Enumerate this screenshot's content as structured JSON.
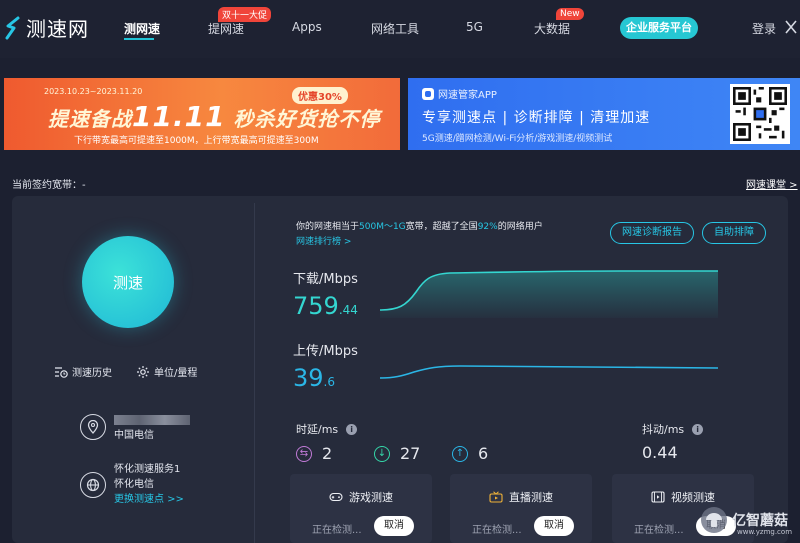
{
  "app": {
    "name": "测速网"
  },
  "nav": {
    "items": [
      {
        "label": "测网速",
        "active": true
      },
      {
        "label": "提网速",
        "badge": "双十一大促"
      },
      {
        "label": "Apps"
      },
      {
        "label": "网络工具"
      },
      {
        "label": "5G"
      },
      {
        "label": "大数据",
        "badge": "New"
      }
    ],
    "cta": "企业服务平台",
    "login": "登录"
  },
  "banner_left": {
    "date": "2023.10.23~2023.11.20",
    "title_a": "提速备战",
    "title_b": "11.11",
    "title_c": "秒杀好货抢不停",
    "pill": "优惠30%",
    "sub": "下行带宽最高可提速至1000M，上行带宽最高可提速至300M"
  },
  "banner_right": {
    "app": "网速管家APP",
    "title": "专享测速点 | 诊断排障 | 清理加速",
    "sub": "5G测速/蹭网检测/Wi-Fi分析/游戏测速/视频测试"
  },
  "bandwidth": {
    "label": "当前签约宽带：-"
  },
  "course_link": "网速课堂 >",
  "speed_button": "测速",
  "tools": {
    "history": "测速历史",
    "units": "单位/量程"
  },
  "server": {
    "isp1": "中国电信",
    "node": "怀化测速服务1",
    "isp2": "怀化电信",
    "change": "更换测速点 >>"
  },
  "headline": {
    "prefix": "你的网速相当于",
    "range": "500M～1G",
    "mid": "宽带，超越了全国",
    "pct": "92%",
    "suffix": "的网络用户"
  },
  "rank_link": "网速排行榜 >",
  "buttons": {
    "report": "网速诊断报告",
    "troubleshoot": "自助排障"
  },
  "download": {
    "label": "下载/Mbps",
    "int": "759",
    "frac": ".44"
  },
  "upload": {
    "label": "上传/Mbps",
    "int": "39",
    "frac": ".6"
  },
  "latency": {
    "title": "时延/ms",
    "values": [
      "2",
      "27",
      "6"
    ]
  },
  "jitter": {
    "title": "抖动/ms",
    "value": "0.44"
  },
  "cards": [
    {
      "title": "游戏测速",
      "status": "正在检测...",
      "cancel": "取消"
    },
    {
      "title": "直播测速",
      "status": "正在检测...",
      "cancel": "取消"
    },
    {
      "title": "视频测速",
      "status": "正在检测...",
      "cancel": "取消"
    }
  ],
  "watermark": {
    "name": "亿智蘑菇",
    "site": "www.yzmg.com"
  },
  "colors": {
    "accent": "#27c6e5",
    "background": "#1c2030",
    "panel": "#262b3b"
  }
}
